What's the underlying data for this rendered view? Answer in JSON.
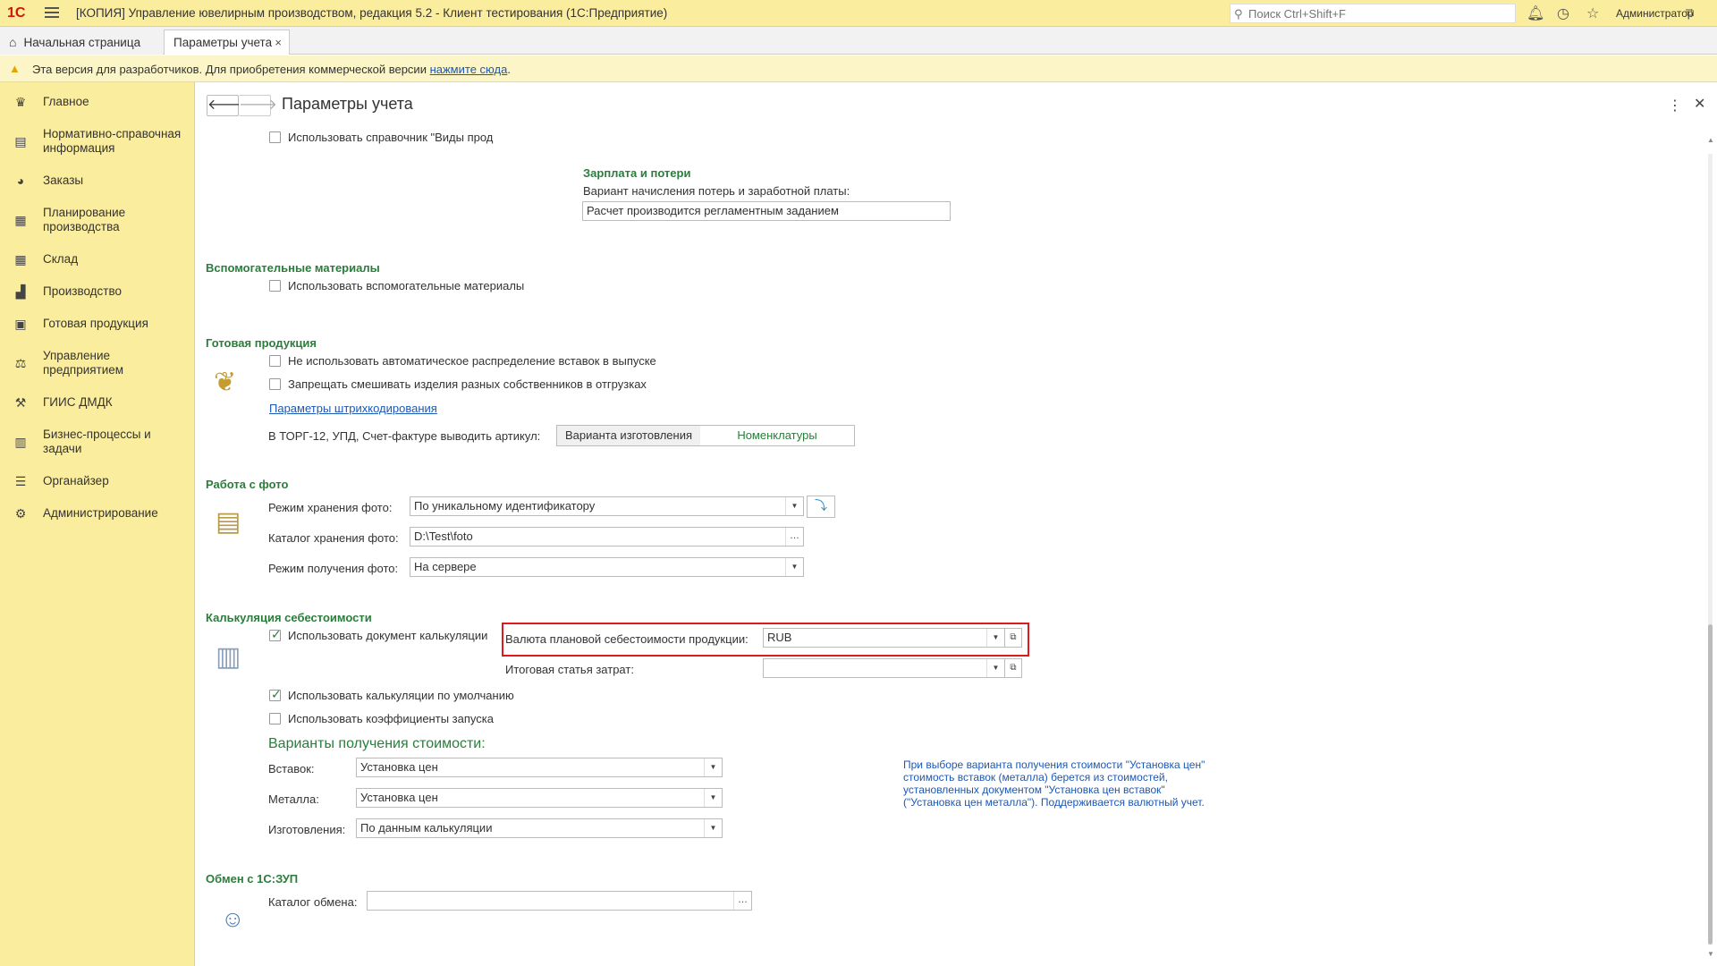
{
  "app": {
    "logo": "1С",
    "title": "[КОПИЯ] Управление ювелирным производством, редакция 5.2  - Клиент тестирования (1С:Предприятие)",
    "search_placeholder": "Поиск Ctrl+Shift+F",
    "user": "Администратор"
  },
  "tabs": [
    {
      "label": "Начальная страница"
    },
    {
      "label": "Параметры учета"
    }
  ],
  "warning": {
    "text": "Эта версия для разработчиков. Для приобретения коммерческой версии ",
    "link": "нажмите сюда",
    "suffix": "."
  },
  "sidebar": {
    "items": [
      {
        "label": "Главное",
        "icon": "crown-icon"
      },
      {
        "label": "Нормативно-справочная информация",
        "icon": "book-icon"
      },
      {
        "label": "Заказы",
        "icon": "pie-chart-icon"
      },
      {
        "label": "Планирование производства",
        "icon": "clipboard-icon"
      },
      {
        "label": "Склад",
        "icon": "grid-icon"
      },
      {
        "label": "Производство",
        "icon": "factory-icon"
      },
      {
        "label": "Готовая продукция",
        "icon": "bag-icon"
      },
      {
        "label": "Управление предприятием",
        "icon": "chart-icon"
      },
      {
        "label": "ГИИС ДМДК",
        "icon": "tool-icon"
      },
      {
        "label": "Бизнес-процессы и задачи",
        "icon": "building-icon"
      },
      {
        "label": "Органайзер",
        "icon": "sliders-icon"
      },
      {
        "label": "Администрирование",
        "icon": "gear-icon"
      }
    ]
  },
  "page": {
    "title": "Параметры учета"
  },
  "content": {
    "top_partial_checkbox": "Использовать справочник \"Виды прод",
    "salary": {
      "title": "Зарплата и потери",
      "label": "Вариант начисления потерь и заработной платы:",
      "value": "Расчет производится регламентным заданием"
    },
    "aux": {
      "title": "Вспомогательные материалы",
      "checkbox": "Использовать вспомогательные материалы"
    },
    "finished": {
      "title": "Готовая продукция",
      "checkbox1": "Не использовать автоматическое распределение вставок в выпуске",
      "checkbox2": "Запрещать смешивать изделия разных собственников в отгрузках",
      "link": "Параметры штрихкодирования",
      "article_label": "В ТОРГ-12, УПД, Счет-фактуре выводить артикул:",
      "option1": "Варианта изготовления",
      "option2": "Номенклатуры"
    },
    "photo": {
      "title": "Работа с фото",
      "storage_mode_label": "Режим хранения фото:",
      "storage_mode_value": "По уникальному идентификатору",
      "catalog_label": "Каталог хранения фото:",
      "catalog_value": "D:\\Test\\foto",
      "receive_mode_label": "Режим получения фото:",
      "receive_mode_value": "На сервере"
    },
    "costing": {
      "title": "Калькуляция себестоимости",
      "checkbox_use_doc": "Использовать документ калькуляции",
      "currency_label": "Валюта плановой себестоимости продукции:",
      "currency_value": "RUB",
      "cost_item_label": "Итоговая статья затрат:",
      "cost_item_value": "",
      "checkbox_default": "Использовать калькуляции по умолчанию",
      "checkbox_coef": "Использовать коэффициенты запуска",
      "variants_title": "Варианты получения стоимости:",
      "inserts_label": "Вставок:",
      "inserts_value": "Установка цен",
      "metal_label": "Металла:",
      "metal_value": "Установка цен",
      "manuf_label": "Изготовления:",
      "manuf_value": "По данным калькуляции",
      "note_line1": "При выборе варианта получения стоимости \"Установка цен\"",
      "note_line2": "стоимость вставок (металла) берется из стоимостей,",
      "note_line3": "установленных документом \"Установка цен вставок\"",
      "note_line4": "(\"Установка цен металла\"). Поддерживается валютный учет."
    },
    "exchange": {
      "title": "Обмен с 1С:ЗУП",
      "catalog_label": "Каталог обмена:",
      "catalog_value": ""
    }
  },
  "colors": {
    "accent_green": "#2a7d3a",
    "link_blue": "#1c58b5",
    "highlight_red": "#e0191c",
    "panel_yellow": "#fbed9e"
  }
}
